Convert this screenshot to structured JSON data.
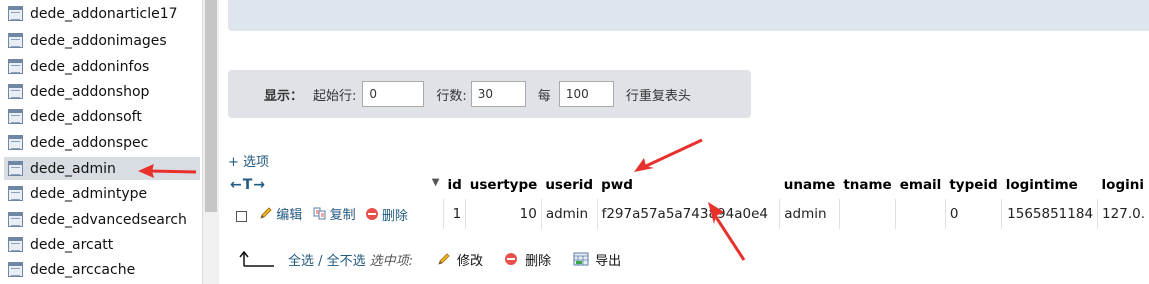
{
  "sidebar": {
    "items": [
      {
        "label": "dede_addonarticle17",
        "active": false
      },
      {
        "label": "dede_addonimages",
        "active": false
      },
      {
        "label": "dede_addoninfos",
        "active": false
      },
      {
        "label": "dede_addonshop",
        "active": false
      },
      {
        "label": "dede_addonsoft",
        "active": false
      },
      {
        "label": "dede_addonspec",
        "active": false
      },
      {
        "label": "dede_admin",
        "active": true
      },
      {
        "label": "dede_admintype",
        "active": false
      },
      {
        "label": "dede_advancedsearch",
        "active": false
      },
      {
        "label": "dede_arcatt",
        "active": false
      },
      {
        "label": "dede_arccache",
        "active": false
      }
    ],
    "icon": "table-icon"
  },
  "display_options": {
    "label": "显示：",
    "start_row_label": "起始行:",
    "start_row_value": "0",
    "rows_label": "行数:",
    "rows_value": "30",
    "every_label": "每",
    "every_value": "100",
    "repeat_header_label": "行重复表头"
  },
  "options_link": "+ 选项",
  "table": {
    "nav_arrows": "←T→",
    "columns": [
      "id",
      "usertype",
      "userid",
      "pwd",
      "uname",
      "tname",
      "email",
      "typeid",
      "logintime",
      "logini"
    ],
    "row": {
      "edit": "编辑",
      "copy": "复制",
      "delete": "删除",
      "id": "1",
      "usertype": "10",
      "userid": "admin",
      "pwd": "f297a57a5a743894a0e4",
      "uname": "admin",
      "tname": "",
      "email": "",
      "typeid": "0",
      "logintime": "1565851184",
      "loginip": "127.0."
    }
  },
  "bulk": {
    "select_all": "全选 / 全不选",
    "selected_label": "选中项:",
    "modify": "修改",
    "delete": "删除",
    "export": "导出"
  },
  "colors": {
    "link": "#235a81",
    "annotation_arrow": "#e8312b",
    "panel": "#dfe3e8",
    "active_row": "#d8dde3"
  }
}
